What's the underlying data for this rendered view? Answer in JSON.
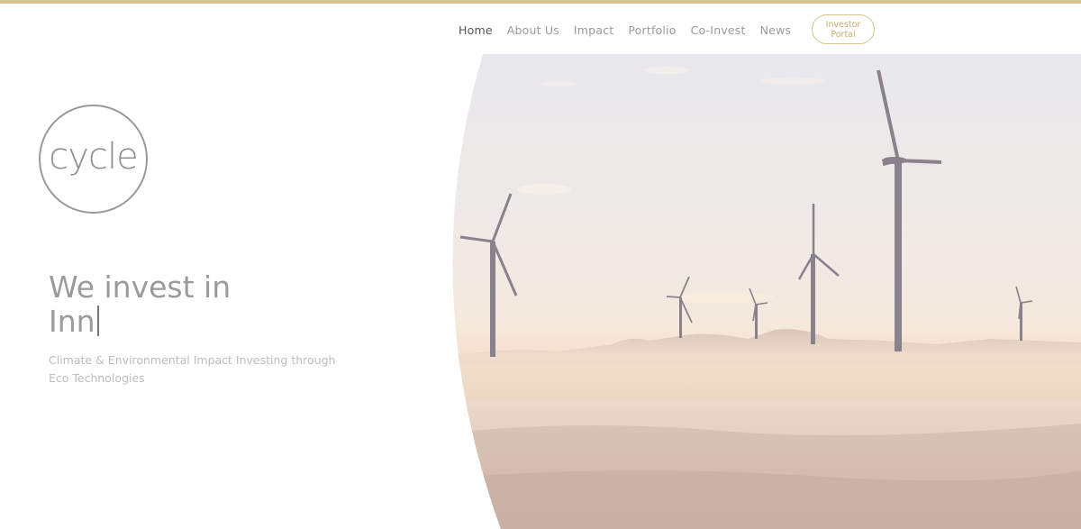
{
  "nav": {
    "items": [
      {
        "label": "Home",
        "active": true
      },
      {
        "label": "About Us",
        "active": false
      },
      {
        "label": "Impact",
        "active": false
      },
      {
        "label": "Portfolio",
        "active": false
      },
      {
        "label": "Co-Invest",
        "active": false
      },
      {
        "label": "News",
        "active": false
      }
    ],
    "investor_portal": {
      "line1": "Investor",
      "line2": "Portal"
    }
  },
  "logo": {
    "text": "cycle"
  },
  "hero": {
    "title_line1": "We invest in",
    "title_line2": "Inn",
    "subtitle": "Climate & Environmental Impact Investing through Eco Technologies"
  },
  "colors": {
    "accent": "#d6c48e",
    "text_gray": "#9b9b9b"
  }
}
